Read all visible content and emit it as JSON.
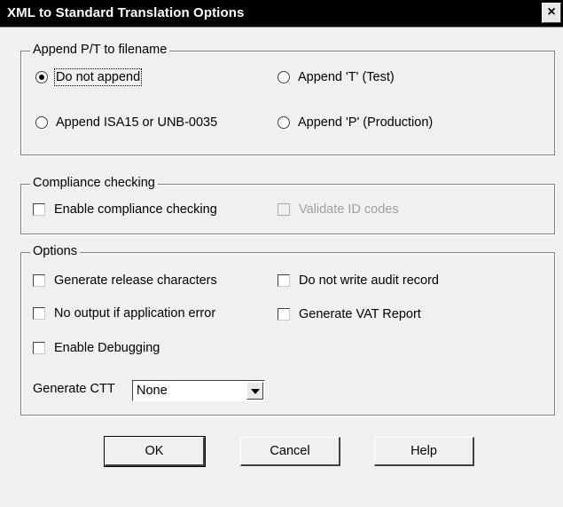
{
  "window": {
    "title": "XML to Standard Translation Options",
    "close_label": "×"
  },
  "append_group": {
    "legend": "Append P/T to filename",
    "options": [
      {
        "label": "Do not append",
        "selected": true
      },
      {
        "label": "Append 'T' (Test)",
        "selected": false
      },
      {
        "label": "Append ISA15 or UNB-0035",
        "selected": false
      },
      {
        "label": "Append 'P' (Production)",
        "selected": false
      }
    ]
  },
  "compliance_group": {
    "legend": "Compliance checking",
    "enable_label": "Enable compliance checking",
    "validate_label": "Validate ID codes"
  },
  "options_group": {
    "legend": "Options",
    "generate_release_label": "Generate release characters",
    "no_audit_label": "Do not write audit record",
    "no_output_label": "No output if application error",
    "vat_report_label": "Generate VAT Report",
    "debugging_label": "Enable Debugging",
    "ctt_label": "Generate CTT",
    "ctt_value": "None"
  },
  "buttons": {
    "ok": "OK",
    "cancel": "Cancel",
    "help": "Help"
  }
}
